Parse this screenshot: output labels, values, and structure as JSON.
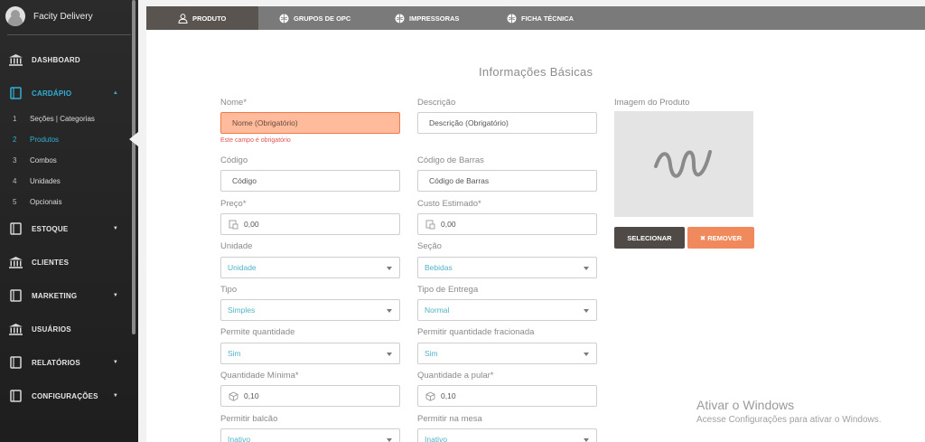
{
  "sidebar": {
    "brand_name": "Facity Delivery",
    "menu": {
      "dashboard": "DASHBOARD",
      "cardapio": "CARDÁPIO",
      "estoque": "ESTOQUE",
      "clientes": "CLIENTES",
      "marketing": "MARKETING",
      "usuarios": "USUÁRIOS",
      "relatorios": "RELATÓRIOS",
      "configuracoes": "CONFIGURAÇÕES"
    },
    "submenu": [
      {
        "num": "1",
        "label": "Seções | Categorias"
      },
      {
        "num": "2",
        "label": "Produtos"
      },
      {
        "num": "3",
        "label": "Combos"
      },
      {
        "num": "4",
        "label": "Unidades"
      },
      {
        "num": "5",
        "label": "Opcionais"
      }
    ],
    "active_color": "#31b0d5"
  },
  "tabs": {
    "produto": "PRODUTO",
    "grupos": "GRUPOS DE OPC",
    "impressoras": "IMPRESSORAS",
    "ficha": "FICHA TÉCNICA"
  },
  "form": {
    "section_title": "Informações Básicas",
    "nome": {
      "label": "Nome*",
      "placeholder": "Nome (Obrigatório)",
      "error": "Este campo é obrigatório"
    },
    "descricao": {
      "label": "Descrição",
      "placeholder": "Descrição (Obrigatório)"
    },
    "codigo": {
      "label": "Código",
      "placeholder": "Código"
    },
    "codigo_barras": {
      "label": "Código de Barras",
      "placeholder": "Código de Barras"
    },
    "preco": {
      "label": "Preço*",
      "value": "0,00"
    },
    "custo": {
      "label": "Custo Estimado*",
      "value": "0,00"
    },
    "unidade": {
      "label": "Unidade",
      "value": "Unidade"
    },
    "secao": {
      "label": "Seção",
      "value": "Bebidas"
    },
    "tipo": {
      "label": "Tipo",
      "value": "Simples"
    },
    "tipo_entrega": {
      "label": "Tipo de Entrega",
      "value": "Normal"
    },
    "permite_qtd": {
      "label": "Permite quantidade",
      "value": "Sim"
    },
    "permitir_fracionada": {
      "label": "Permitir quantidade fracionada",
      "value": "Sim"
    },
    "qtd_minima": {
      "label": "Quantidade Mínima*",
      "value": "0,10"
    },
    "qtd_pular": {
      "label": "Quantidade a pular*",
      "value": "0,10"
    },
    "permitir_balcao": {
      "label": "Permitir balcão",
      "value": "Inativo"
    },
    "permitir_mesa": {
      "label": "Permitir na mesa",
      "value": "Inativo"
    },
    "imagem": {
      "label": "Imagem do Produto",
      "select_button": "SELECIONAR",
      "remove_button": "✖ REMOVER"
    }
  },
  "watermark": {
    "title": "Ativar o Windows",
    "subtitle": "Acesse Configurações para ativar o Windows."
  },
  "colors": {
    "error_bg": "#ffbb9c",
    "accent": "#31b0d5",
    "remove": "#f08a5d"
  }
}
